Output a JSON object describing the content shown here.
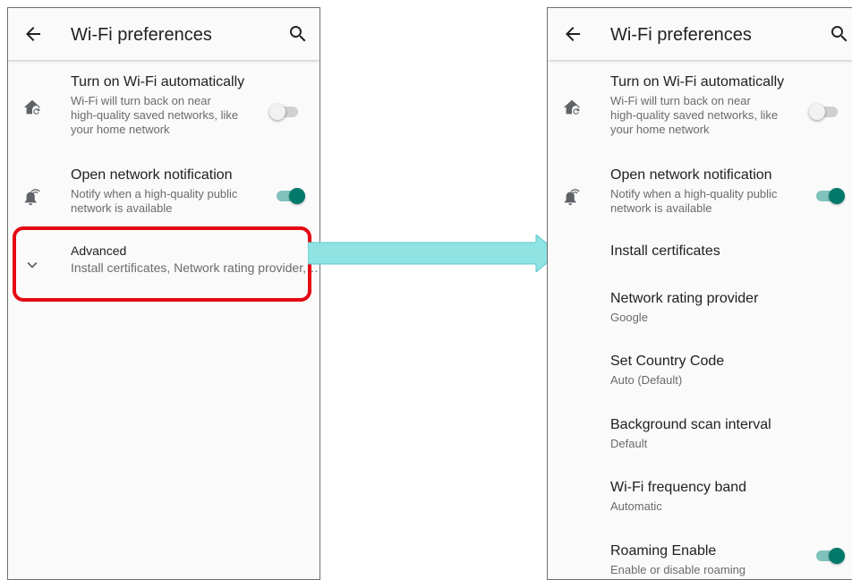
{
  "left_screen": {
    "appbar": {
      "title": "Wi-Fi preferences"
    },
    "turn_on_wifi": {
      "title": "Turn on Wi-Fi automatically",
      "subtitle_lines": [
        "Wi-Fi will turn back on near",
        "high-quality saved networks, like",
        "your home network"
      ],
      "toggle": "off"
    },
    "open_network": {
      "title": "Open network notification",
      "subtitle_lines": [
        "Notify when a high-quality public",
        "network is available"
      ],
      "toggle": "on"
    },
    "advanced": {
      "title": "Advanced",
      "subtitle": "Install certificates, Network rating provider,…"
    }
  },
  "right_screen": {
    "appbar": {
      "title": "Wi-Fi preferences"
    },
    "turn_on_wifi": {
      "title": "Turn on Wi-Fi automatically",
      "subtitle_lines": [
        "Wi-Fi will turn back on near",
        "high-quality saved networks, like",
        "your home network"
      ],
      "toggle": "off"
    },
    "open_network": {
      "title": "Open network notification",
      "subtitle_lines": [
        "Notify when a high-quality public",
        "network is available"
      ],
      "toggle": "on"
    },
    "install_certificates": {
      "title": "Install certificates"
    },
    "network_rating_provider": {
      "title": "Network rating provider",
      "value": "Google"
    },
    "set_country_code": {
      "title": "Set Country Code",
      "value": "Auto (Default)"
    },
    "background_scan_interval": {
      "title": "Background scan interval",
      "value": "Default"
    },
    "wifi_frequency_band": {
      "title": "Wi-Fi frequency band",
      "value": "Automatic"
    },
    "roaming_enable": {
      "title": "Roaming Enable",
      "subtitle": "Enable or disable roaming",
      "toggle": "on"
    }
  },
  "icons": {
    "back": "arrow-back-icon",
    "search": "search-icon",
    "home_wifi": "home-auto-icon",
    "notification": "notification-wifi-icon",
    "expand": "chevron-down-icon"
  },
  "colors": {
    "accent": "#00796b",
    "highlight_border": "#e50914",
    "arrow_fill": "#8fe3e3",
    "background": "#fafafa"
  }
}
